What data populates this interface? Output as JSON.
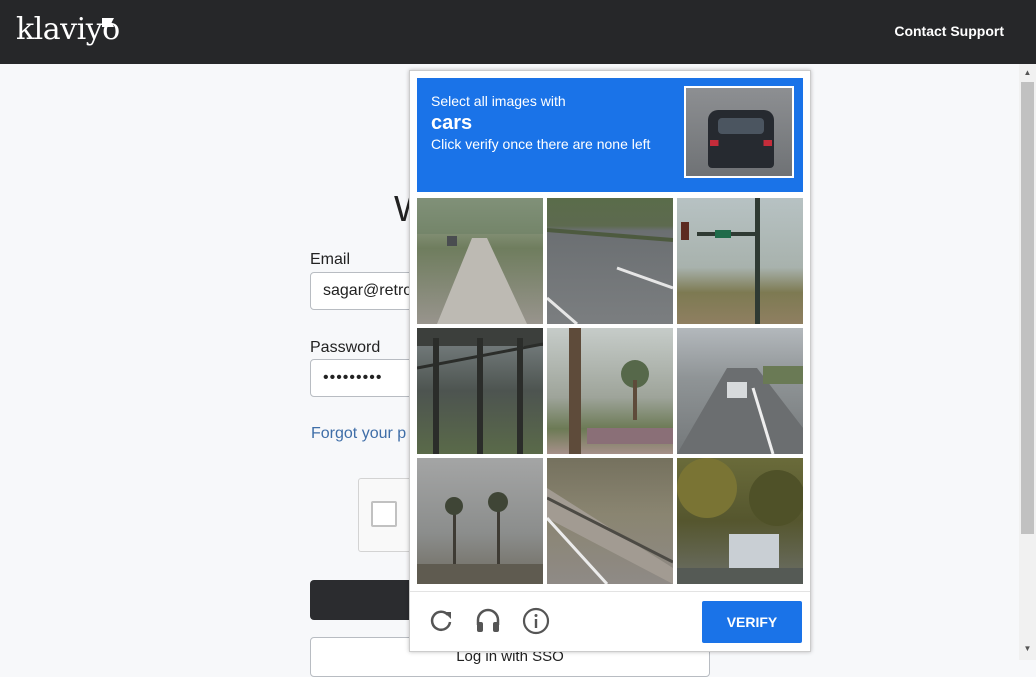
{
  "header": {
    "logo": "klaviyo",
    "contact_support": "Contact Support"
  },
  "login": {
    "heading_partial": "W",
    "email_label": "Email",
    "email_value": "sagar@retro",
    "password_label": "Password",
    "password_value": "•••••••••",
    "forgot_partial": "Forgot your p",
    "sso_label": "Log in with SSO"
  },
  "captcha": {
    "instruction_line1": "Select all images with",
    "target": "cars",
    "instruction_line3": "Click verify once there are none left",
    "verify_label": "VERIFY",
    "tiles": [
      {
        "name": "tile-1",
        "desc": "road with trees"
      },
      {
        "name": "tile-2",
        "desc": "highway lanes"
      },
      {
        "name": "tile-3",
        "desc": "traffic signal pole"
      },
      {
        "name": "tile-4",
        "desc": "bridge structure"
      },
      {
        "name": "tile-5",
        "desc": "palm tree"
      },
      {
        "name": "tile-6",
        "desc": "highway with car"
      },
      {
        "name": "tile-7",
        "desc": "palm trees skyline"
      },
      {
        "name": "tile-8",
        "desc": "roadside rail"
      },
      {
        "name": "tile-9",
        "desc": "trees with car"
      }
    ],
    "icons": [
      "reload-icon",
      "audio-icon",
      "info-icon"
    ]
  },
  "colors": {
    "topbar": "#262729",
    "captcha_blue": "#1a73e8",
    "link": "#3f6ea8"
  }
}
